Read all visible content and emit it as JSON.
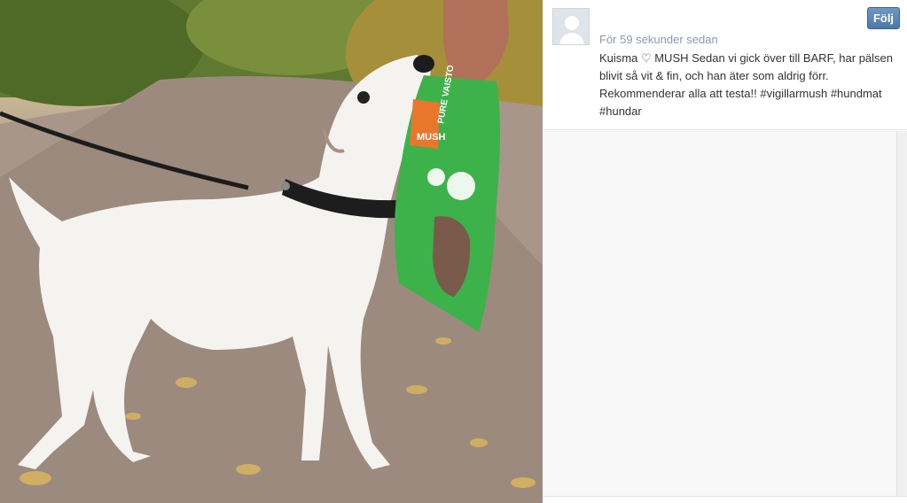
{
  "photo": {
    "subject": "photo-dog-with-food-bag",
    "bag_brand_text": "MUSH",
    "bag_product_text": "PURE VAISTO"
  },
  "post": {
    "avatar_icon": "user-avatar-icon",
    "follow_label": "Följ",
    "timestamp": "För 59 sekunder sedan",
    "caption": "Kuisma ♡ MUSH Sedan vi gick över till BARF, har pälsen blivit så vit & fin, och han äter som aldrig förr. Rekommenderar alla att testa!! #vigillarmush #hundmat #hundar"
  },
  "colors": {
    "follow_button": "#4c78a8",
    "timestamp_text": "#8a9aad",
    "comments_bg": "#f8f8f8",
    "bag_green": "#3db14a",
    "bag_orange": "#e8762c"
  }
}
